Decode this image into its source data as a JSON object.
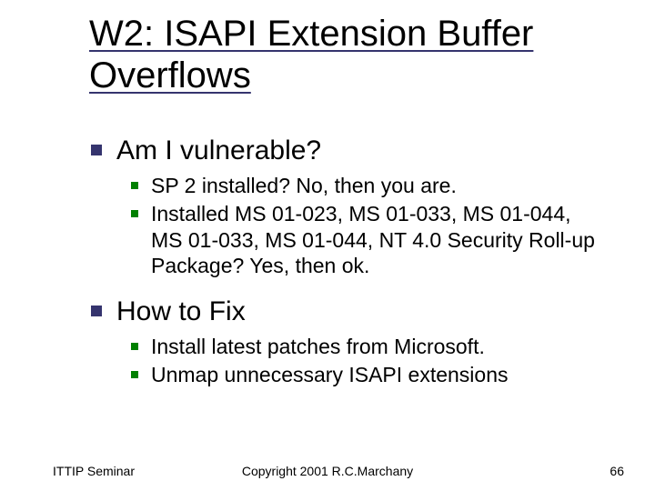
{
  "title": "W2: ISAPI Extension Buffer Overflows",
  "sections": [
    {
      "heading": "Am I vulnerable?",
      "items": [
        "SP 2 installed? No, then you are.",
        "Installed MS 01-023, MS 01-033, MS 01-044, MS 01-033, MS 01-044, NT 4.0 Security Roll-up Package? Yes, then ok."
      ]
    },
    {
      "heading": "How to Fix",
      "items": [
        "Install latest patches from Microsoft.",
        "Unmap unnecessary ISAPI extensions"
      ]
    }
  ],
  "footer": {
    "left": "ITTIP Seminar",
    "center": "Copyright 2001 R.C.Marchany",
    "right": "66"
  }
}
